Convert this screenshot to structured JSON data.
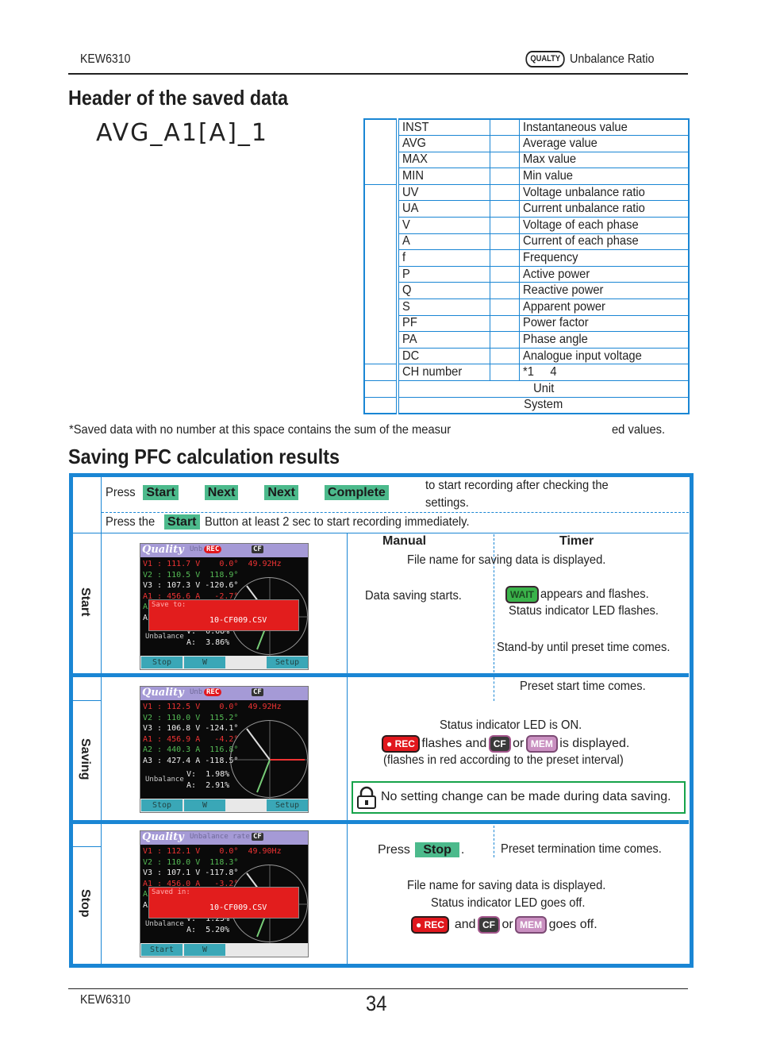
{
  "page_header": {
    "model": "KEW6310",
    "badge": "QUALTY",
    "section": "Unbalance Ratio"
  },
  "header_section": {
    "title": "Header of the saved data",
    "example": "AVG_A1[A]_1",
    "rows": [
      {
        "code": "INST",
        "desc": "Instantaneous value"
      },
      {
        "code": "AVG",
        "desc": "Average value"
      },
      {
        "code": "MAX",
        "desc": "Max value"
      },
      {
        "code": "MIN",
        "desc": "Min value"
      },
      {
        "code": "UV",
        "desc": "Voltage unbalance ratio"
      },
      {
        "code": "UA",
        "desc": "Current unbalance ratio"
      },
      {
        "code": "V",
        "desc": "Voltage of each phase"
      },
      {
        "code": "A",
        "desc": "Current of each phase"
      },
      {
        "code": "f",
        "desc": "Frequency"
      },
      {
        "code": "P",
        "desc": "Active power"
      },
      {
        "code": "Q",
        "desc": "Reactive power"
      },
      {
        "code": "S",
        "desc": "Apparent power"
      },
      {
        "code": "PF",
        "desc": "Power factor"
      },
      {
        "code": "PA",
        "desc": "Phase angle"
      },
      {
        "code": "DC",
        "desc": "Analogue input voltage"
      },
      {
        "code": "CH number",
        "desc": "*1     4"
      }
    ],
    "unit_label": "Unit",
    "system_label": "System",
    "footnote_a": "*Saved data with no number at this space contains the sum of the measur",
    "footnote_b": "ed values."
  },
  "pfc_section": {
    "title": "Saving PFC calculation results",
    "intro1": {
      "press": "Press",
      "buttons": [
        "Start",
        "Next",
        "Next",
        "Complete"
      ],
      "after": "to start recording after checking the",
      "after2": "settings."
    },
    "intro2": {
      "press": "Press the",
      "button": "Start",
      "after": "Button at least 2 sec to start recording immediately."
    },
    "col_manual": "Manual",
    "col_timer": "Timer",
    "start": {
      "label": "Start",
      "file_name": "File name for saving data is displayed.",
      "manual": "Data saving starts.",
      "wait_chip": "WAIT",
      "timer1": "appears and flashes.",
      "timer2": "Status indicator LED flashes.",
      "timer3": "Stand-by until preset time comes."
    },
    "saving": {
      "label": "Saving",
      "timer": "Preset start time comes.",
      "line1": "Status indicator LED is ON.",
      "rec_chip": "REC",
      "flashes_and": "flashes and",
      "cf_chip": "CF",
      "or": "or",
      "mem_chip": "MEM",
      "is_displayed": "is displayed.",
      "line3": "(flashes in red according to the preset interval)",
      "lock_note": "No setting change can be made during data saving."
    },
    "stop": {
      "label": "Stop",
      "press": "Press",
      "button": "Stop",
      "period": ".",
      "timer": "Preset termination time comes.",
      "line1": "File name for saving data is displayed.",
      "line2": "Status indicator LED goes off.",
      "rec_chip": "REC",
      "and": "and",
      "cf_chip": "CF",
      "or": "or",
      "mem_chip": "MEM",
      "goes_off": "goes off."
    },
    "screens": [
      {
        "brand": "Quality",
        "mode": "Unb",
        "rec": "REC",
        "cf": "CF",
        "rows": [
          "V1 : 111.7 V    0.0°  49.92Hz",
          "V2 : 110.5 V  118.9°",
          "V3 : 107.3 V -120.6°",
          "A1 : 456.6 A   -2.7°",
          "A2 :",
          "A3 :"
        ],
        "popup_label": "Save to:",
        "popup_file": "10-CF009.CSV",
        "unbalance": "Unbalance",
        "uv": "V:  0.68%",
        "ua": "A:  3.86%",
        "keys": [
          "Stop",
          "W",
          "",
          "Setup"
        ]
      },
      {
        "brand": "Quality",
        "mode": "Unb",
        "rec": "REC",
        "cf": "CF",
        "rows": [
          "V1 : 112.5 V    0.0°  49.92Hz",
          "V2 : 110.0 V  115.2°",
          "V3 : 106.8 V -124.1°",
          "A1 : 456.9 A   -4.2°",
          "A2 : 440.3 A  116.8°",
          "A3 : 427.4 A -118.5°"
        ],
        "popup_label": "",
        "popup_file": "",
        "unbalance": "Unbalance",
        "uv": "V:  1.98%",
        "ua": "A:  2.91%",
        "keys": [
          "Stop",
          "W",
          "",
          "Setup"
        ]
      },
      {
        "brand": "Quality",
        "mode": "Unbalance rate",
        "rec": "",
        "cf": "CF",
        "rows": [
          "V1 : 112.1 V    0.0°  49.90Hz",
          "V2 : 110.0 V  118.3°",
          "V3 : 107.1 V -117.8°",
          "A1 : 456.0 A   -3.2°",
          "A2 :",
          "A3 :"
        ],
        "popup_label": "Saved in:",
        "popup_file": "10-CF009.CSV",
        "unbalance": "Unbalance",
        "uv": "V:  1.25%",
        "ua": "A:  5.20%",
        "keys": [
          "Start",
          "W",
          "",
          ""
        ]
      }
    ]
  },
  "page_footer": {
    "model": "KEW6310",
    "page_number": "34"
  },
  "colors": {
    "accent_blue": "#1a86d4",
    "button_green": "#4cba8c",
    "rec_red": "#e1171d",
    "lock_green": "#16a34a"
  }
}
